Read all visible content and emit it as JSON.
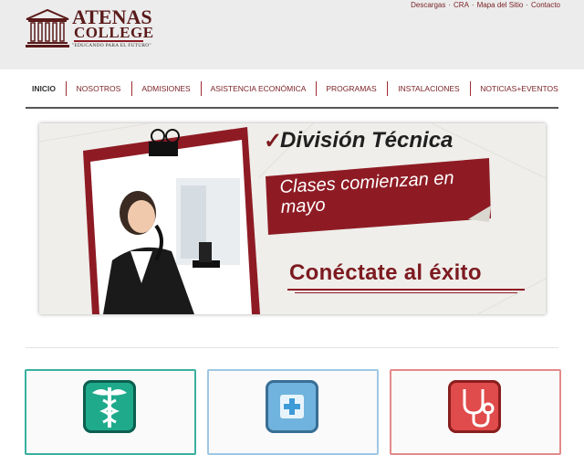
{
  "brand": {
    "name": "ATENAS",
    "name2": "COLLEGE",
    "slogan": "\"EDUCANDO PARA EL FUTURO\""
  },
  "toplinks": [
    "Descargas",
    "CRA",
    "Mapa del Sitio",
    "Contacto"
  ],
  "nav": {
    "items": [
      {
        "label": "INICIO"
      },
      {
        "label": "NOSOTROS"
      },
      {
        "label": "ADMISIONES"
      },
      {
        "label": "ASISTENCIA ECONÓMICA"
      },
      {
        "label": "PROGRAMAS"
      },
      {
        "label": "INSTALACIONES"
      },
      {
        "label": "NOTICIAS+EVENTOS"
      }
    ]
  },
  "banner": {
    "check": "✓",
    "title": "División Técnica",
    "subtitle": "Clases comienzan en mayo",
    "tagline": "Conéctate al éxito"
  },
  "cards": [
    {
      "icon": "caduceus-icon",
      "border": "#3ab0a0",
      "color": "#1faa8c"
    },
    {
      "icon": "medical-cross-icon",
      "border": "#9fc7e4",
      "color": "#6fb3de"
    },
    {
      "icon": "stethoscope-icon",
      "border": "#e38a8a",
      "color": "#e04b4b"
    }
  ],
  "colors": {
    "brand": "#7a1f24",
    "header_bg": "#ececec"
  }
}
